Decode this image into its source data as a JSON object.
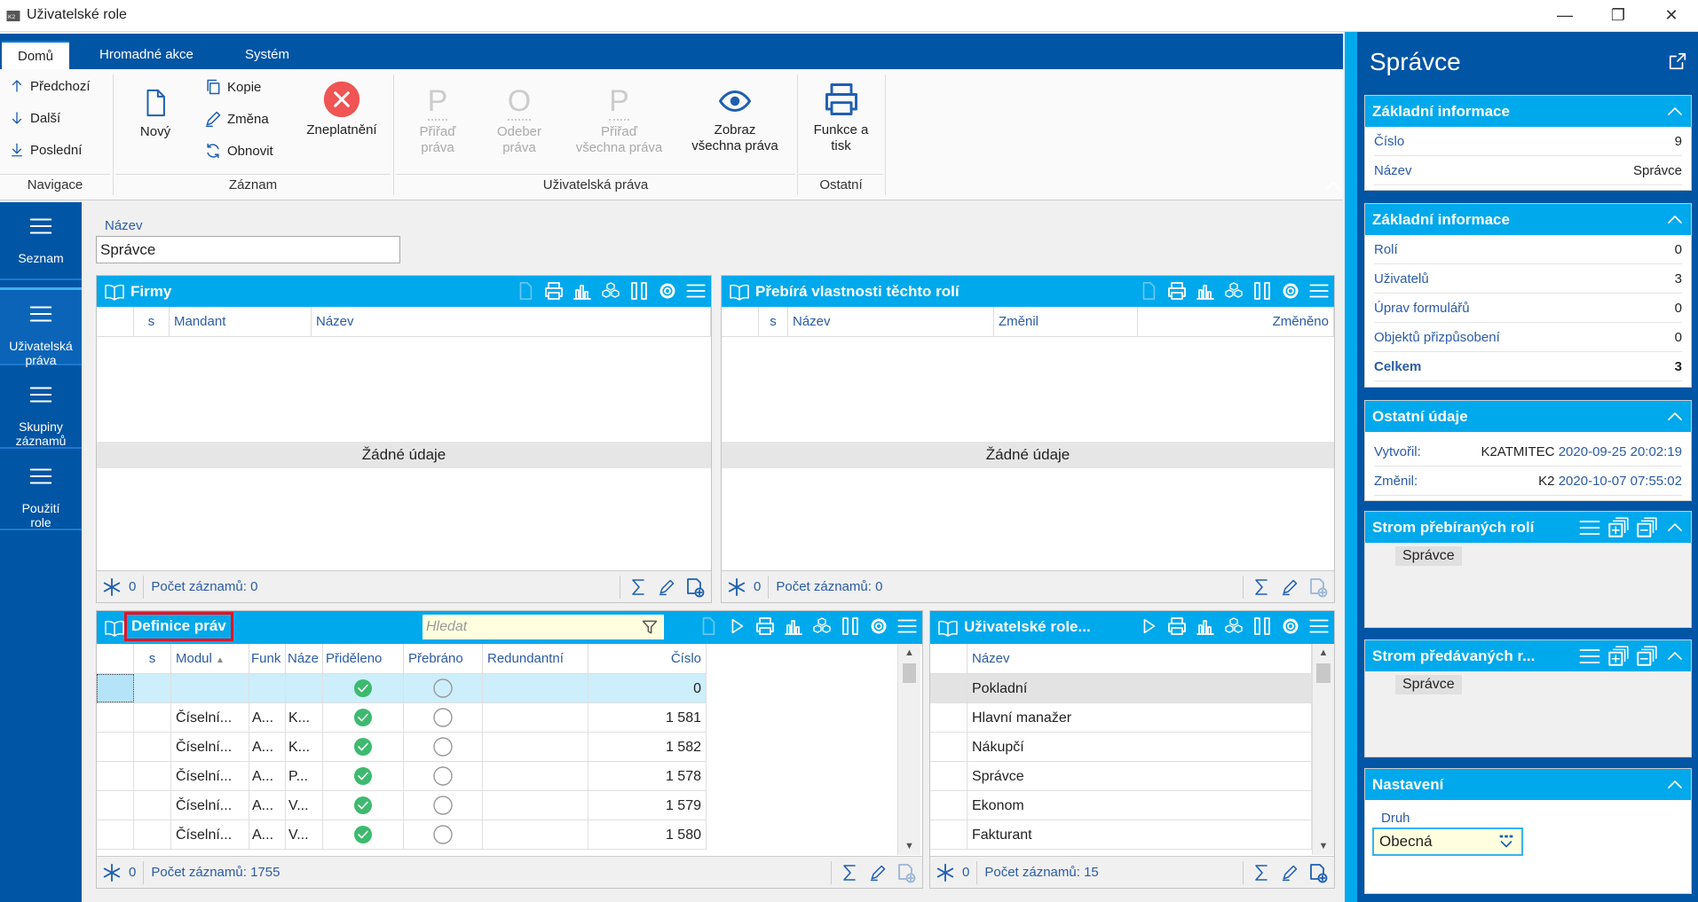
{
  "window": {
    "title": "Uživatelské role"
  },
  "ribbon": {
    "tabs": [
      "Domů",
      "Hromadné akce",
      "Systém"
    ],
    "navigation": {
      "label": "Navigace",
      "items": [
        "Předchozí",
        "Další",
        "Poslední"
      ]
    },
    "record": {
      "label": "Záznam",
      "new": "Nový",
      "copy": "Kopie",
      "change": "Změna",
      "refresh": "Obnovit",
      "invalidate": "Zneplatnění"
    },
    "user_rights": {
      "label": "Uživatelská práva",
      "assign": [
        "Přiřaď",
        "práva"
      ],
      "remove": [
        "Odeber",
        "práva"
      ],
      "assign_all": [
        "Přiřaď",
        "všechna práva"
      ],
      "show_all": [
        "Zobraz",
        "všechna práva"
      ]
    },
    "other": {
      "label": "Ostatní",
      "print": [
        "Funkce a",
        "tisk"
      ]
    }
  },
  "sidebar": {
    "items": [
      [
        "Seznam"
      ],
      [
        "Uživatelská",
        "práva"
      ],
      [
        "Skupiny",
        "záznamů"
      ],
      [
        "Použití",
        "role"
      ]
    ]
  },
  "form": {
    "name_label": "Název",
    "name_value": "Správce"
  },
  "firmy": {
    "title": "Firmy",
    "columns": [
      "s",
      "Mandant",
      "Název"
    ],
    "empty": "Žádné údaje",
    "count": "0",
    "records": "Počet záznamů: 0"
  },
  "inherits": {
    "title": "Přebírá vlastnosti těchto rolí",
    "columns": [
      "s",
      "Název",
      "Změnil",
      "Změněno"
    ],
    "empty": "Žádné údaje",
    "count": "0",
    "records": "Počet záznamů: 0"
  },
  "rights": {
    "title": "Definice práv",
    "search_placeholder": "Hledat",
    "columns": [
      "s",
      "Modul",
      "Funk",
      "Náze",
      "Přiděleno",
      "Přebráno",
      "Redundantní",
      "Číslo"
    ],
    "rows": [
      {
        "modul": "",
        "funk": "",
        "naz": "",
        "assigned": true,
        "inherited": false,
        "cislo": "0"
      },
      {
        "modul": "Číselní...",
        "funk": "A...",
        "naz": "K...",
        "assigned": true,
        "inherited": false,
        "cislo": "1 581"
      },
      {
        "modul": "Číselní...",
        "funk": "A...",
        "naz": "K...",
        "assigned": true,
        "inherited": false,
        "cislo": "1 582"
      },
      {
        "modul": "Číselní...",
        "funk": "A...",
        "naz": "P...",
        "assigned": true,
        "inherited": false,
        "cislo": "1 578"
      },
      {
        "modul": "Číselní...",
        "funk": "A...",
        "naz": "V...",
        "assigned": true,
        "inherited": false,
        "cislo": "1 579"
      },
      {
        "modul": "Číselní...",
        "funk": "A...",
        "naz": "V...",
        "assigned": true,
        "inherited": false,
        "cislo": "1 580"
      }
    ],
    "count": "0",
    "records": "Počet záznamů: 1755"
  },
  "roles": {
    "title": "Uživatelské role...",
    "column": "Název",
    "rows": [
      "Pokladní",
      "Hlavní manažer",
      "Nákupčí",
      "Správce",
      "Ekonom",
      "Fakturant"
    ],
    "count": "0",
    "records": "Počet záznamů: 15"
  },
  "right": {
    "title": "Správce",
    "basic1": {
      "title": "Základní informace",
      "rows": [
        {
          "k": "Číslo",
          "v": "9"
        },
        {
          "k": "Název",
          "v": "Správce"
        }
      ]
    },
    "basic2": {
      "title": "Základní informace",
      "rows": [
        {
          "k": "Rolí",
          "v": "0"
        },
        {
          "k": "Uživatelů",
          "v": "3"
        },
        {
          "k": "Úprav formulářů",
          "v": "0"
        },
        {
          "k": "Objektů přizpůsobení",
          "v": "0"
        },
        {
          "k": "Celkem",
          "v": "3"
        }
      ]
    },
    "other": {
      "title": "Ostatní údaje",
      "created_label": "Vytvořil:",
      "created_by": "K2ATMITEC",
      "created_at": "2020-09-25 20:02:19",
      "changed_label": "Změnil:",
      "changed_by": "K2",
      "changed_at": "2020-10-07 07:55:02"
    },
    "tree1": {
      "title": "Strom přebíraných rolí",
      "item": "Správce"
    },
    "tree2": {
      "title": "Strom předávaných r...",
      "item": "Správce"
    },
    "settings": {
      "title": "Nastavení",
      "kind_label": "Druh",
      "kind_value": "Obecná"
    }
  },
  "colors": {
    "dark_blue": "#0055a5",
    "header_blue": "#00a9ec",
    "label_blue": "#2b5ba5",
    "check_green": "#3dba6f",
    "invalidate_red": "#f05454",
    "highlight_red": "#e81123"
  }
}
